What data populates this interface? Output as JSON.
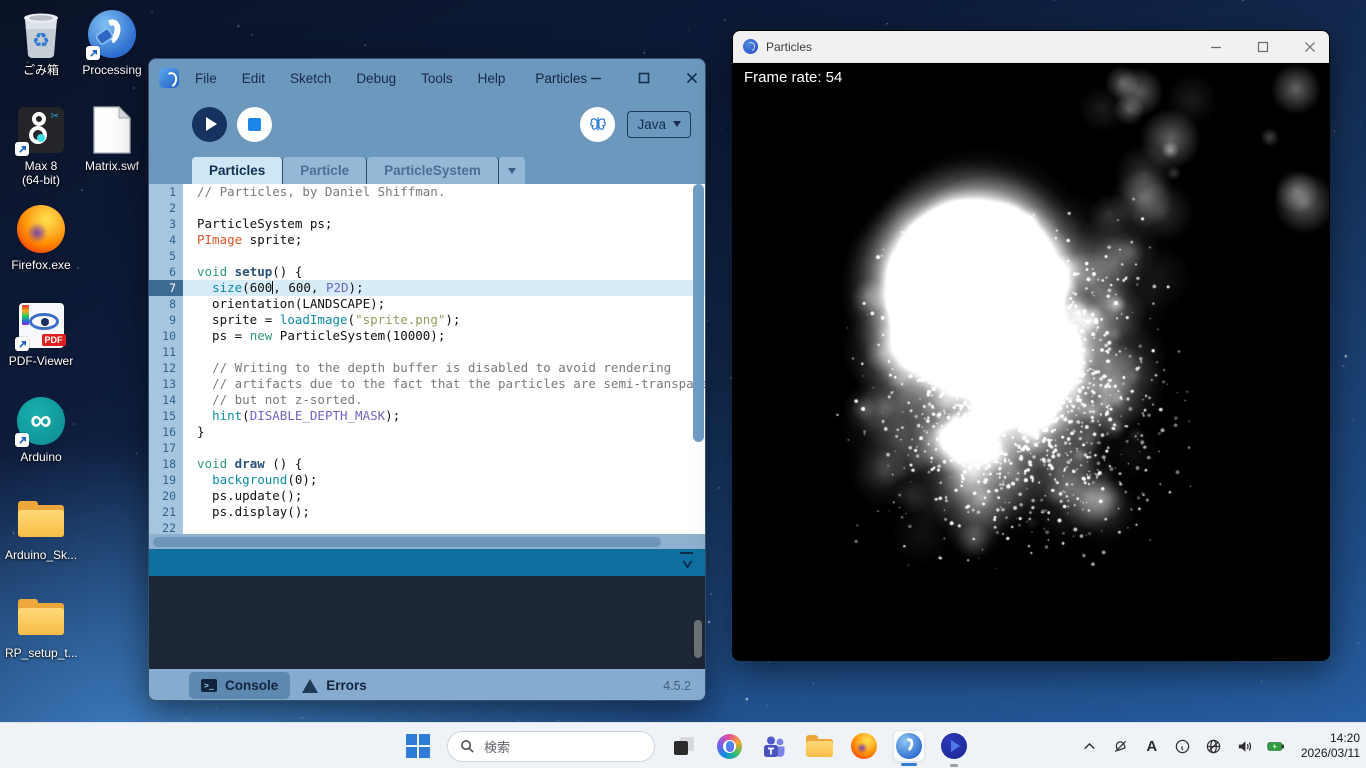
{
  "desktop": {
    "icons": [
      {
        "name": "recycle-bin",
        "label": "ごみ箱"
      },
      {
        "name": "processing",
        "label": "Processing"
      },
      {
        "name": "max8",
        "label": "Max 8",
        "label2": "(64-bit)"
      },
      {
        "name": "matrix-swf",
        "label": "Matrix.swf"
      },
      {
        "name": "firefox",
        "label": "Firefox.exe"
      },
      {
        "name": "pdf-viewer",
        "label": "PDF-Viewer"
      },
      {
        "name": "arduino",
        "label": "Arduino"
      },
      {
        "name": "arduino-sketches-folder",
        "label": "Arduino_Sk..."
      },
      {
        "name": "rp-setup-folder",
        "label": "RP_setup_t..."
      }
    ]
  },
  "ide": {
    "title": "Particles",
    "menus": [
      "File",
      "Edit",
      "Sketch",
      "Debug",
      "Tools",
      "Help"
    ],
    "mode": {
      "label": "Java"
    },
    "tabs": [
      "Particles",
      "Particle",
      "ParticleSystem"
    ],
    "active_tab": "Particles",
    "code_lines": [
      {
        "n": 1,
        "hl": false,
        "t": [
          [
            "c",
            "// Particles, by Daniel Shiffman."
          ]
        ]
      },
      {
        "n": 2,
        "hl": false,
        "t": []
      },
      {
        "n": 3,
        "hl": false,
        "t": [
          [
            "p",
            "ParticleSystem ps;"
          ]
        ]
      },
      {
        "n": 4,
        "hl": false,
        "t": [
          [
            "t",
            "PImage"
          ],
          [
            "p",
            " sprite;"
          ]
        ]
      },
      {
        "n": 5,
        "hl": false,
        "t": []
      },
      {
        "n": 6,
        "hl": false,
        "t": [
          [
            "k",
            "void "
          ],
          [
            "b",
            "setup"
          ],
          [
            "p",
            "() {"
          ]
        ]
      },
      {
        "n": 7,
        "hl": true,
        "t": [
          [
            "p",
            "  "
          ],
          [
            "f",
            "size"
          ],
          [
            "p",
            "(600"
          ],
          [
            "caret",
            ""
          ],
          [
            "p",
            ", 600, "
          ],
          [
            "n",
            "P2D"
          ],
          [
            "p",
            ");"
          ]
        ]
      },
      {
        "n": 8,
        "hl": false,
        "t": [
          [
            "p",
            "  orientation(LANDSCAPE);"
          ]
        ]
      },
      {
        "n": 9,
        "hl": false,
        "t": [
          [
            "p",
            "  sprite = "
          ],
          [
            "f",
            "loadImage"
          ],
          [
            "p",
            "("
          ],
          [
            "s",
            "\"sprite.png\""
          ],
          [
            "p",
            ");"
          ]
        ]
      },
      {
        "n": 10,
        "hl": false,
        "t": [
          [
            "p",
            "  ps = "
          ],
          [
            "k",
            "new"
          ],
          [
            "p",
            " ParticleSystem(10000);"
          ]
        ]
      },
      {
        "n": 11,
        "hl": false,
        "t": []
      },
      {
        "n": 12,
        "hl": false,
        "t": [
          [
            "p",
            "  "
          ],
          [
            "c",
            "// Writing to the depth buffer is disabled to avoid rendering"
          ]
        ]
      },
      {
        "n": 13,
        "hl": false,
        "t": [
          [
            "p",
            "  "
          ],
          [
            "c",
            "// artifacts due to the fact that the particles are semi-transparent"
          ]
        ]
      },
      {
        "n": 14,
        "hl": false,
        "t": [
          [
            "p",
            "  "
          ],
          [
            "c",
            "// but not z-sorted."
          ]
        ]
      },
      {
        "n": 15,
        "hl": false,
        "t": [
          [
            "p",
            "  "
          ],
          [
            "f",
            "hint"
          ],
          [
            "p",
            "("
          ],
          [
            "n",
            "DISABLE_DEPTH_MASK"
          ],
          [
            "p",
            ");"
          ]
        ]
      },
      {
        "n": 16,
        "hl": false,
        "t": [
          [
            "p",
            "}"
          ]
        ]
      },
      {
        "n": 17,
        "hl": false,
        "t": []
      },
      {
        "n": 18,
        "hl": false,
        "t": [
          [
            "k",
            "void "
          ],
          [
            "b",
            "draw"
          ],
          [
            "p",
            " () {"
          ]
        ]
      },
      {
        "n": 19,
        "hl": false,
        "t": [
          [
            "p",
            "  "
          ],
          [
            "f",
            "background"
          ],
          [
            "p",
            "(0);"
          ]
        ]
      },
      {
        "n": 20,
        "hl": false,
        "t": [
          [
            "p",
            "  ps.update();"
          ]
        ]
      },
      {
        "n": 21,
        "hl": false,
        "t": [
          [
            "p",
            "  ps.display();"
          ]
        ]
      },
      {
        "n": 22,
        "hl": false,
        "t": []
      }
    ],
    "footer": {
      "console_label": "Console",
      "errors_label": "Errors",
      "terminal_glyph": ">_",
      "version": "4.5.2"
    }
  },
  "sketch_window": {
    "title": "Particles",
    "frame_rate_label": "Frame rate: 54",
    "visualization": {
      "type": "particle-cloud",
      "background": "#000000",
      "particle_color": "#ffffff",
      "cluster_center": [
        0.46,
        0.52
      ],
      "cluster_spread": [
        0.3,
        0.32
      ],
      "core_center": [
        0.4,
        0.37
      ],
      "core_radius_frac": 0.18,
      "blob_count": 470,
      "sparkle_count": 1500,
      "seed": 11
    }
  },
  "taskbar": {
    "search_placeholder": "検索",
    "clock_time": "14:20",
    "clock_date": "2026/03/11"
  },
  "colors": {
    "ide_chrome": "#6d98bd",
    "ide_console_bg": "#1d2634",
    "ide_strip": "#0f70a0",
    "accent_blue": "#2f7fd6",
    "run_button": "#16335f",
    "stop_square": "#1e86e8"
  }
}
